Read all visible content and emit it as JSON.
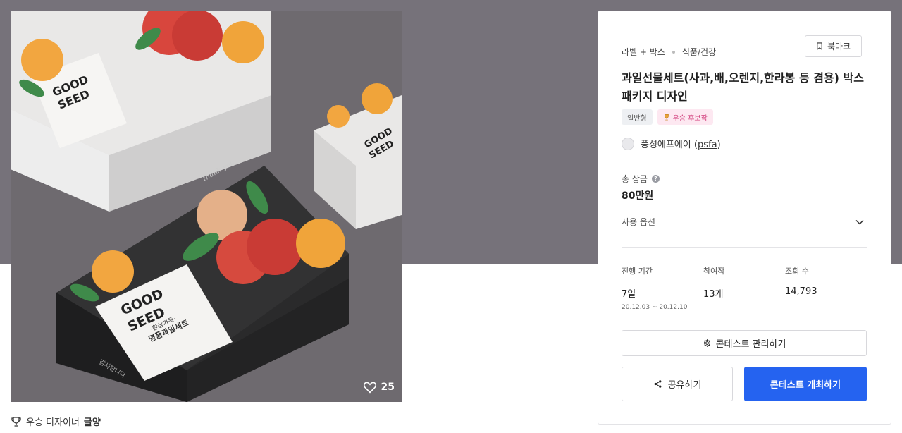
{
  "hero": {
    "like_count": "25",
    "box_brand_top": "GOOD",
    "box_brand_bottom": "SEED",
    "box_tagline": "·한상가득·",
    "box_product": "명품과일세트",
    "box_script": "thank you",
    "box_side": "감사합니다"
  },
  "winner": {
    "label": "우승 디자이너",
    "name": "글양"
  },
  "card": {
    "category_main": "라벨 + 박스",
    "category_sub": "식품/건강",
    "bookmark_label": "북마크",
    "title": "과일선물세트(사과,배,오렌지,한라봉 등 겸용) 박스 패키지 디자인",
    "tags": {
      "type": "일반형",
      "award": "우승 후보작"
    },
    "holder_name": "풍성에프에이",
    "holder_handle": "psfa",
    "prize_label": "총 상금",
    "prize_help": "?",
    "prize_value": "80만원",
    "options_label": "사용 옵션",
    "stats": {
      "period_label": "진행 기간",
      "period_value": "7일",
      "period_dates": "20.12.03 ~ 20.12.10",
      "entries_label": "참여작",
      "entries_value": "13개",
      "views_label": "조회 수",
      "views_value": "14,793"
    },
    "manage_label": "콘테스트 관리하기",
    "share_label": "공유하기",
    "host_label": "콘테스트 개최하기"
  },
  "colors": {
    "primary": "#2563f0",
    "award_bg": "#fde8f1",
    "award_text": "#d23d7c",
    "band": "#76727a"
  },
  "icons": [
    "bookmark-icon",
    "trophy-icon",
    "help-icon",
    "chevron-down-icon",
    "gear-icon",
    "share-icon",
    "heart-icon"
  ]
}
